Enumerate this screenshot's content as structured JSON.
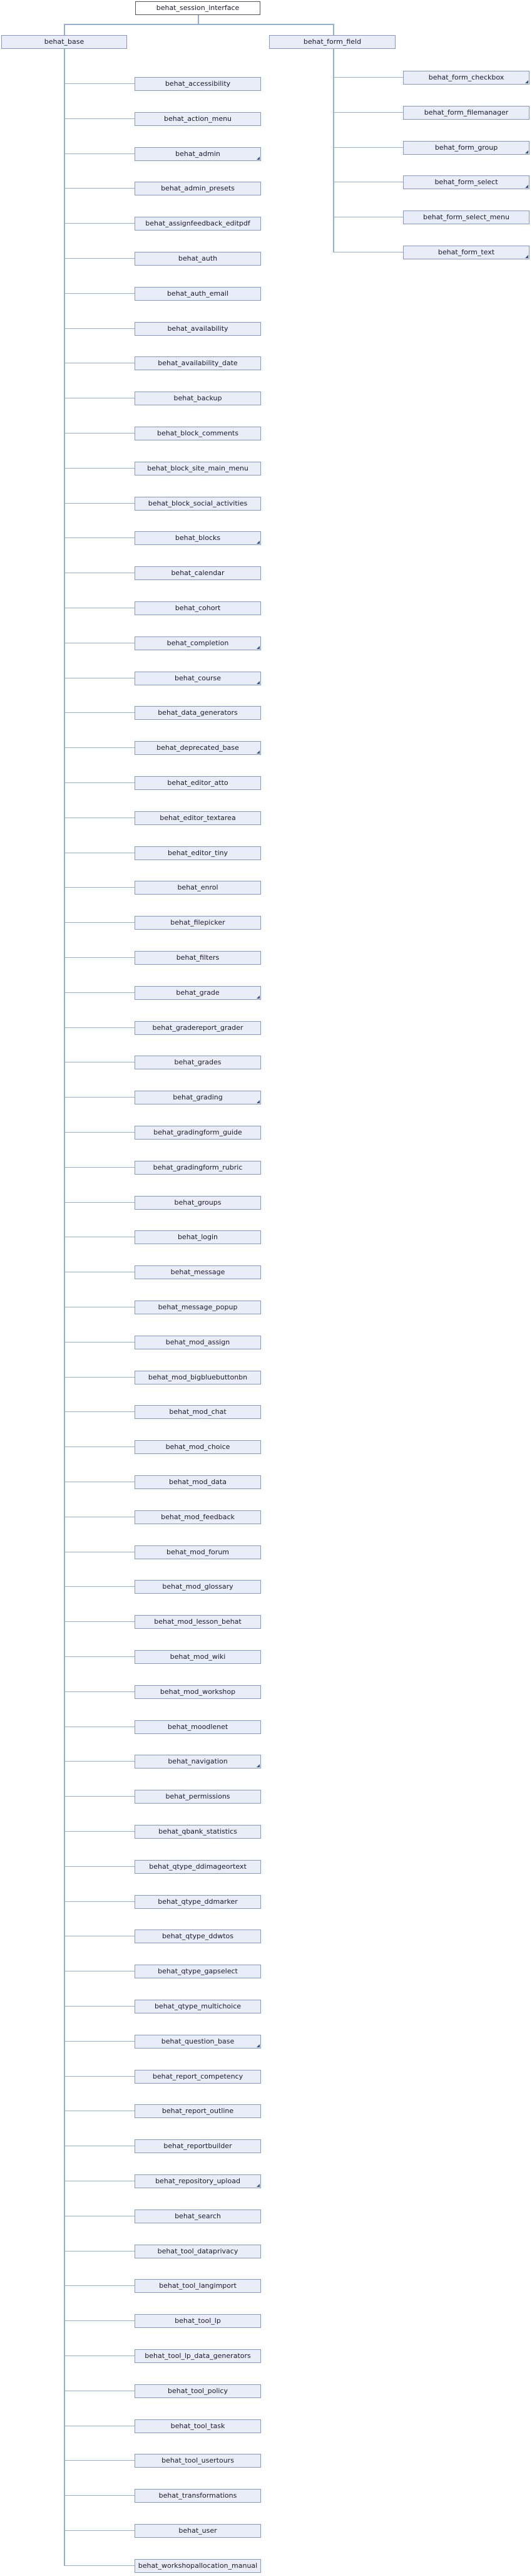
{
  "root": "behat_session_interface",
  "level1": [
    "behat_base",
    "behat_form_field"
  ],
  "base_children": [
    {
      "label": "behat_accessibility",
      "more": false
    },
    {
      "label": "behat_action_menu",
      "more": false
    },
    {
      "label": "behat_admin",
      "more": true
    },
    {
      "label": "behat_admin_presets",
      "more": false
    },
    {
      "label": "behat_assignfeedback_editpdf",
      "more": false
    },
    {
      "label": "behat_auth",
      "more": false
    },
    {
      "label": "behat_auth_email",
      "more": false
    },
    {
      "label": "behat_availability",
      "more": false
    },
    {
      "label": "behat_availability_date",
      "more": false
    },
    {
      "label": "behat_backup",
      "more": false
    },
    {
      "label": "behat_block_comments",
      "more": false
    },
    {
      "label": "behat_block_site_main_menu",
      "more": false
    },
    {
      "label": "behat_block_social_activities",
      "more": false
    },
    {
      "label": "behat_blocks",
      "more": true
    },
    {
      "label": "behat_calendar",
      "more": false
    },
    {
      "label": "behat_cohort",
      "more": false
    },
    {
      "label": "behat_completion",
      "more": true
    },
    {
      "label": "behat_course",
      "more": true
    },
    {
      "label": "behat_data_generators",
      "more": false
    },
    {
      "label": "behat_deprecated_base",
      "more": true
    },
    {
      "label": "behat_editor_atto",
      "more": false
    },
    {
      "label": "behat_editor_textarea",
      "more": false
    },
    {
      "label": "behat_editor_tiny",
      "more": false
    },
    {
      "label": "behat_enrol",
      "more": false
    },
    {
      "label": "behat_filepicker",
      "more": false
    },
    {
      "label": "behat_filters",
      "more": false
    },
    {
      "label": "behat_grade",
      "more": true
    },
    {
      "label": "behat_gradereport_grader",
      "more": false
    },
    {
      "label": "behat_grades",
      "more": false
    },
    {
      "label": "behat_grading",
      "more": true
    },
    {
      "label": "behat_gradingform_guide",
      "more": false
    },
    {
      "label": "behat_gradingform_rubric",
      "more": false
    },
    {
      "label": "behat_groups",
      "more": false
    },
    {
      "label": "behat_login",
      "more": false
    },
    {
      "label": "behat_message",
      "more": false
    },
    {
      "label": "behat_message_popup",
      "more": false
    },
    {
      "label": "behat_mod_assign",
      "more": false
    },
    {
      "label": "behat_mod_bigbluebuttonbn",
      "more": false
    },
    {
      "label": "behat_mod_chat",
      "more": false
    },
    {
      "label": "behat_mod_choice",
      "more": false
    },
    {
      "label": "behat_mod_data",
      "more": false
    },
    {
      "label": "behat_mod_feedback",
      "more": false
    },
    {
      "label": "behat_mod_forum",
      "more": false
    },
    {
      "label": "behat_mod_glossary",
      "more": false
    },
    {
      "label": "behat_mod_lesson_behat",
      "more": false
    },
    {
      "label": "behat_mod_wiki",
      "more": false
    },
    {
      "label": "behat_mod_workshop",
      "more": false
    },
    {
      "label": "behat_moodlenet",
      "more": false
    },
    {
      "label": "behat_navigation",
      "more": true
    },
    {
      "label": "behat_permissions",
      "more": false
    },
    {
      "label": "behat_qbank_statistics",
      "more": false
    },
    {
      "label": "behat_qtype_ddimageortext",
      "more": false
    },
    {
      "label": "behat_qtype_ddmarker",
      "more": false
    },
    {
      "label": "behat_qtype_ddwtos",
      "more": false
    },
    {
      "label": "behat_qtype_gapselect",
      "more": false
    },
    {
      "label": "behat_qtype_multichoice",
      "more": false
    },
    {
      "label": "behat_question_base",
      "more": true
    },
    {
      "label": "behat_report_competency",
      "more": false
    },
    {
      "label": "behat_report_outline",
      "more": false
    },
    {
      "label": "behat_reportbuilder",
      "more": false
    },
    {
      "label": "behat_repository_upload",
      "more": true
    },
    {
      "label": "behat_search",
      "more": false
    },
    {
      "label": "behat_tool_dataprivacy",
      "more": false
    },
    {
      "label": "behat_tool_langimport",
      "more": false
    },
    {
      "label": "behat_tool_lp",
      "more": false
    },
    {
      "label": "behat_tool_lp_data_generators",
      "more": false
    },
    {
      "label": "behat_tool_policy",
      "more": false
    },
    {
      "label": "behat_tool_task",
      "more": false
    },
    {
      "label": "behat_tool_usertours",
      "more": false
    },
    {
      "label": "behat_transformations",
      "more": false
    },
    {
      "label": "behat_user",
      "more": false
    },
    {
      "label": "behat_workshopallocation_manual",
      "more": false
    }
  ],
  "field_children": [
    {
      "label": "behat_form_checkbox",
      "more": true
    },
    {
      "label": "behat_form_filemanager",
      "more": false
    },
    {
      "label": "behat_form_group",
      "more": true
    },
    {
      "label": "behat_form_select",
      "more": true
    },
    {
      "label": "behat_form_select_menu",
      "more": false
    },
    {
      "label": "behat_form_text",
      "more": true
    }
  ],
  "colors": {
    "node_fill": "#e8edf8",
    "node_border": "#8497c8",
    "root_fill": "#ffffff",
    "edge": "#8fb0d8",
    "fold_marker": "#3a4e8c"
  }
}
